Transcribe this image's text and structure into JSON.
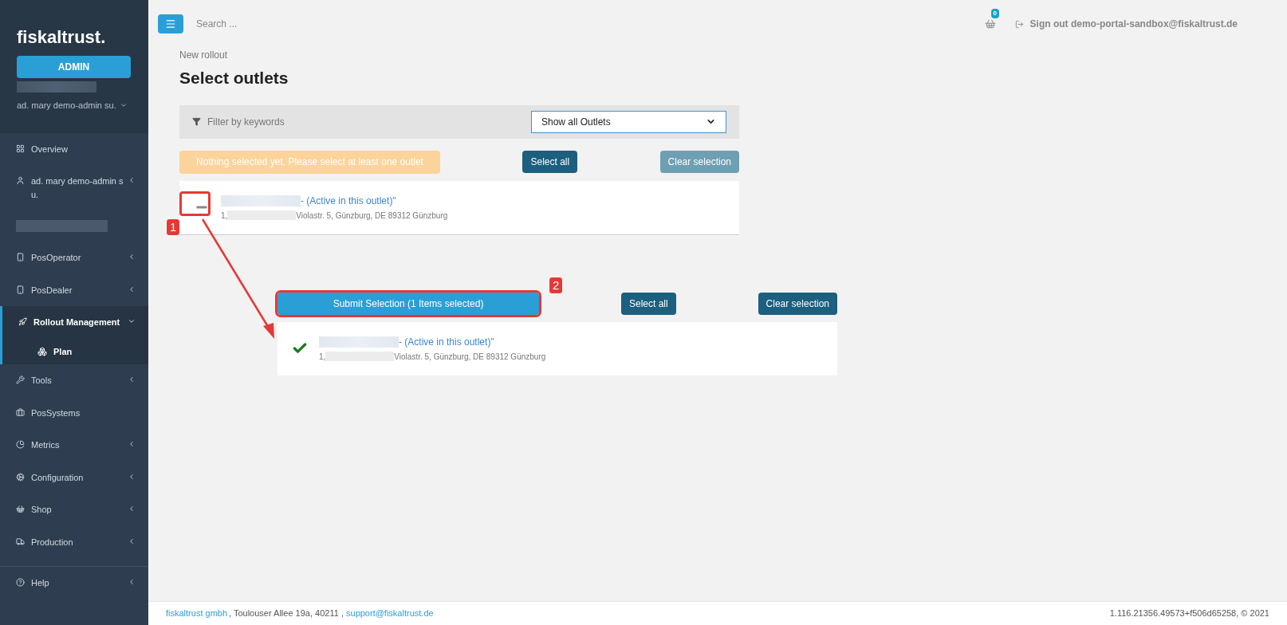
{
  "sidebar": {
    "logo": "fiskaltrust.",
    "role_button": "ADMIN",
    "user_menu": "ad. mary demo-admin su.",
    "items": [
      {
        "label": "Overview",
        "has_submenu": false,
        "expanded": false,
        "selected": false
      },
      {
        "label": "ad. mary demo-admin s u.",
        "has_submenu": true,
        "expanded": false,
        "selected": false
      },
      {
        "kind": "redacted"
      },
      {
        "label": "PosOperator",
        "has_submenu": true,
        "expanded": false,
        "selected": false
      },
      {
        "label": "PosDealer",
        "has_submenu": true,
        "expanded": false,
        "selected": false
      },
      {
        "label": "Rollout Management",
        "has_submenu": true,
        "expanded": true,
        "selected": true,
        "children": [
          {
            "label": "Plan",
            "selected": false
          }
        ]
      },
      {
        "label": "Tools",
        "has_submenu": true,
        "expanded": false,
        "selected": false
      },
      {
        "label": "PosSystems",
        "has_submenu": false,
        "expanded": false,
        "selected": false
      },
      {
        "label": "Metrics",
        "has_submenu": true,
        "expanded": false,
        "selected": false
      },
      {
        "label": "Configuration",
        "has_submenu": true,
        "expanded": false,
        "selected": false
      },
      {
        "label": "Shop",
        "has_submenu": true,
        "expanded": false,
        "selected": false
      },
      {
        "label": "Production",
        "has_submenu": true,
        "expanded": false,
        "selected": false
      },
      {
        "label": "Help",
        "has_submenu": true,
        "expanded": false,
        "selected": false
      }
    ]
  },
  "topbar": {
    "search": {
      "placeholder": "Search ..."
    },
    "cart_count": "0",
    "sign_out": "Sign out demo-portal-sandbox@fiskaltrust.de"
  },
  "page": {
    "breadcrumb": "New rollout",
    "title": "Select outlets"
  },
  "filter": {
    "placeholder": "Filter by keywords",
    "select": "Show all Outlets"
  },
  "sections": [
    {
      "kind": "alert",
      "status": "Nothing selected yet. Please select at least one outlet",
      "select_all": "Select all",
      "clear_selection": {
        "label": "Clear selection",
        "disabled": true
      },
      "outlets": [
        {
          "checked": false,
          "status": "- (Active in this outlet)\"",
          "address_prefix": "1,",
          "address": "Violastr. 5, Günzburg, DE 89312 Günzburg"
        }
      ]
    },
    {
      "kind": "submit",
      "status": "Submit Selection (1 Items selected)",
      "select_all": "Select all",
      "clear_selection": {
        "label": "Clear selection",
        "disabled": false
      },
      "outlets": [
        {
          "checked": true,
          "status": "- (Active in this outlet)\"",
          "address_prefix": "1,",
          "address": "Violastr. 5, Günzburg, DE 89312 Günzburg"
        }
      ]
    }
  ],
  "callouts": [
    "1",
    "2"
  ],
  "footer": {
    "company": "fiskaltrust gmbh",
    "address": ", Toulouser Allee 19a, 40211 , ",
    "email": "support@fiskaltrust.de",
    "version": "1.116.21356.49573+f506d65258, © 2021"
  }
}
